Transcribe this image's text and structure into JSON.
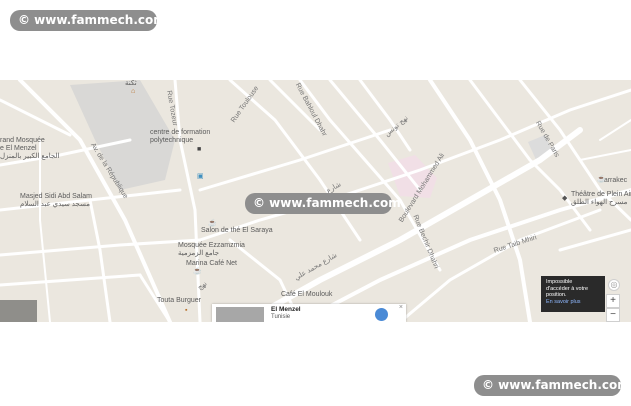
{
  "watermark": {
    "text": "© www.fammech.com"
  },
  "map": {
    "places": {
      "mosque_grand": [
        "rand Mosquée",
        "e El Menzel",
        "الجامع الكبير بالمنزل"
      ],
      "camp": "ثكنة",
      "formation": [
        "centre de formation",
        "polytechnique"
      ],
      "masjed": [
        "Masjed Sidi Abd Salam",
        "مسجد سيدي عبد السلام"
      ],
      "salon": "Salon de thé El Saraya",
      "mosquee_ezzamzmia": [
        "Mosquée Ezzamzmia",
        "جامع الزمزمية"
      ],
      "marina": "Marina Café Net",
      "touta": "Touta Burguer",
      "cafe": "Café El Moulouk",
      "marrakech": "Marrakec",
      "theatre": [
        "Théâtre de Plein Air",
        "مسرح الهواء الطلق"
      ]
    },
    "streets": {
      "toulouse": "Rue Toulouse",
      "tozeur": "Rue Tozeur",
      "bahloul": "Rue Bahloul Dhahr",
      "republique": "Av. de la République",
      "dhahri": "Rue Bechir Dhahri",
      "boulevard": "Boulevard Mohammed Ali",
      "paris": "Rue de Paris",
      "taib": "Rue Taib Mhiri",
      "arabic_mohamed_ali": "شارع محمد علي",
      "arabic_rue": "نهج تونس",
      "arabic_small": "شارع",
      "arabic_n": "نهج"
    },
    "geo_popup": {
      "line1": "Impossible",
      "line2": "d'accéder à votre",
      "line3": "position.",
      "link": "En savoir plus"
    },
    "zoom_in": "+",
    "zoom_out": "−",
    "place_card": {
      "name": "El Menzel",
      "country": "Tunisie",
      "close": "×"
    }
  }
}
